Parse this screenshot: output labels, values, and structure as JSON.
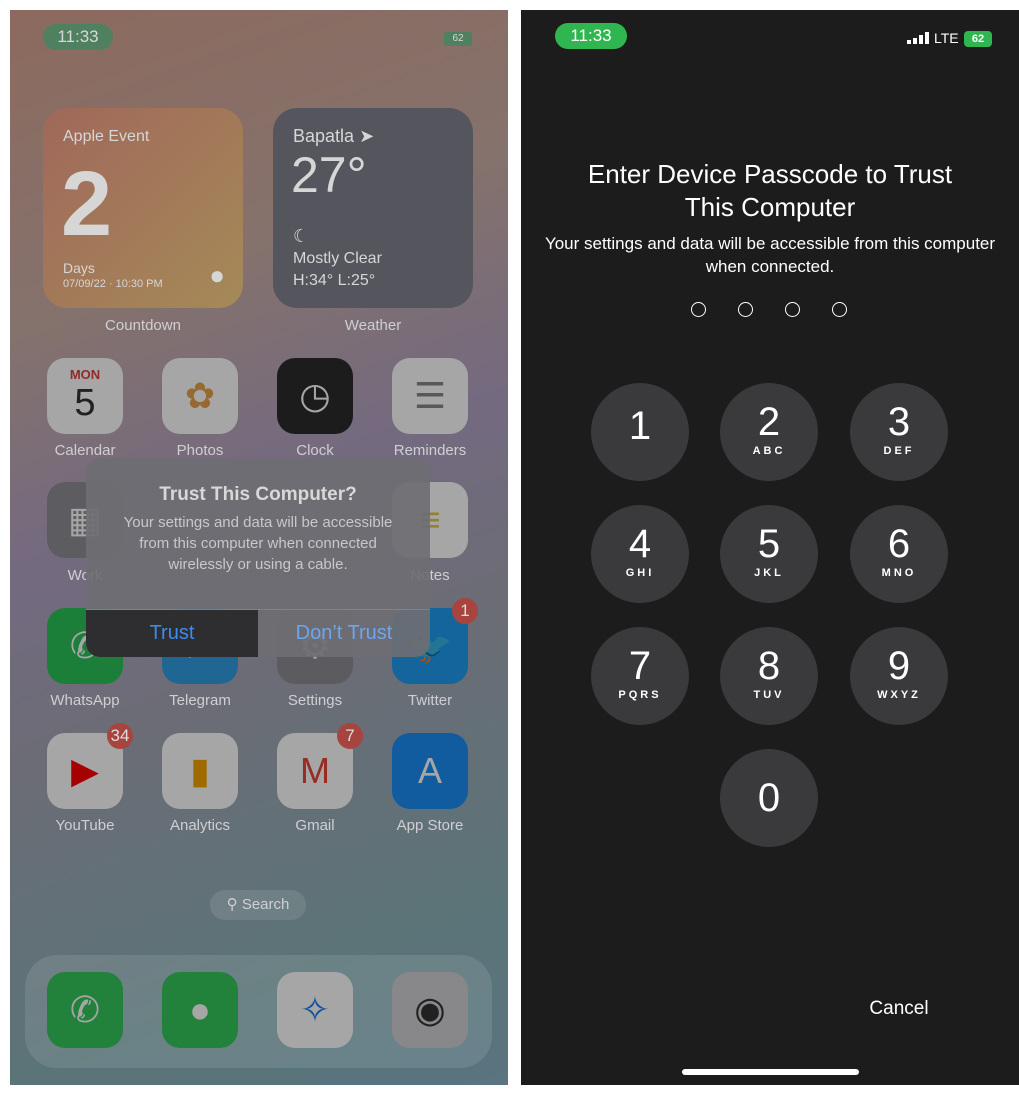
{
  "left_screen": {
    "status": {
      "time": "11:33",
      "battery": "62"
    },
    "widgets": {
      "countdown": {
        "title": "Apple Event",
        "number": "2",
        "unit": "Days",
        "date": "07/09/22 · 10:30 PM",
        "label": "Countdown"
      },
      "weather": {
        "city": "Bapatla",
        "temp": "27°",
        "condition": "Mostly Clear",
        "range": "H:34° L:25°",
        "label": "Weather"
      }
    },
    "apps": [
      {
        "name": "Calendar",
        "icon": "calendar-icon",
        "color": "#ffffff",
        "day": "MON",
        "date": "5"
      },
      {
        "name": "Photos",
        "icon": "photos-icon",
        "color": "#ffffff"
      },
      {
        "name": "Clock",
        "icon": "clock-icon",
        "color": "#2b2b2b"
      },
      {
        "name": "Reminders",
        "icon": "reminders-icon",
        "color": "#ffffff"
      },
      {
        "name": "Work",
        "icon": "folder-icon",
        "color": "#8f8f95"
      },
      {
        "name": "",
        "icon": "hidden-icon",
        "color": "transparent"
      },
      {
        "name": "",
        "icon": "hidden-icon",
        "color": "transparent"
      },
      {
        "name": "Notes",
        "icon": "notes-icon",
        "color": "#ffffff"
      },
      {
        "name": "WhatsApp",
        "icon": "whatsapp-icon",
        "color": "#29c45a"
      },
      {
        "name": "Telegram",
        "icon": "telegram-icon",
        "color": "#2f9fe0"
      },
      {
        "name": "Settings",
        "icon": "settings-icon",
        "color": "#8e8e93"
      },
      {
        "name": "Twitter",
        "icon": "twitter-icon",
        "color": "#1d9bf0",
        "badge": "1"
      },
      {
        "name": "YouTube",
        "icon": "youtube-icon",
        "color": "#ffffff",
        "badge": "34"
      },
      {
        "name": "Analytics",
        "icon": "analytics-icon",
        "color": "#ffffff"
      },
      {
        "name": "Gmail",
        "icon": "gmail-icon",
        "color": "#ffffff",
        "badge": "7"
      },
      {
        "name": "App Store",
        "icon": "app-store-icon",
        "color": "#1a8cf5"
      }
    ],
    "search_label": "Search",
    "dock": [
      {
        "icon": "phone-icon",
        "color": "#34c759"
      },
      {
        "icon": "messages-icon",
        "color": "#34c759"
      },
      {
        "icon": "safari-icon",
        "color": "#ffffff"
      },
      {
        "icon": "camera-icon",
        "color": "#d1d1d6"
      }
    ],
    "alert": {
      "title": "Trust This Computer?",
      "message": "Your settings and data will be accessible from this computer when connected wirelessly or using a cable.",
      "trust_label": "Trust",
      "dont_trust_label": "Don’t Trust"
    }
  },
  "right_screen": {
    "status": {
      "time": "11:33",
      "network": "LTE",
      "battery": "62"
    },
    "title": "Enter Device Passcode to Trust This Computer",
    "subtitle": "Your settings and data will be accessible from this computer when connected.",
    "passcode_length": 4,
    "passcode_entered": 0,
    "keys": [
      {
        "digit": "1",
        "letters": ""
      },
      {
        "digit": "2",
        "letters": "ABC"
      },
      {
        "digit": "3",
        "letters": "DEF"
      },
      {
        "digit": "4",
        "letters": "GHI"
      },
      {
        "digit": "5",
        "letters": "JKL"
      },
      {
        "digit": "6",
        "letters": "MNO"
      },
      {
        "digit": "7",
        "letters": "PQRS"
      },
      {
        "digit": "8",
        "letters": "TUV"
      },
      {
        "digit": "9",
        "letters": "WXYZ"
      },
      {
        "digit": "0",
        "letters": ""
      }
    ],
    "cancel_label": "Cancel"
  },
  "colors": {
    "status_green": "#30b650",
    "ios_blue": "#3478f6",
    "badge_red": "#f0443a"
  }
}
